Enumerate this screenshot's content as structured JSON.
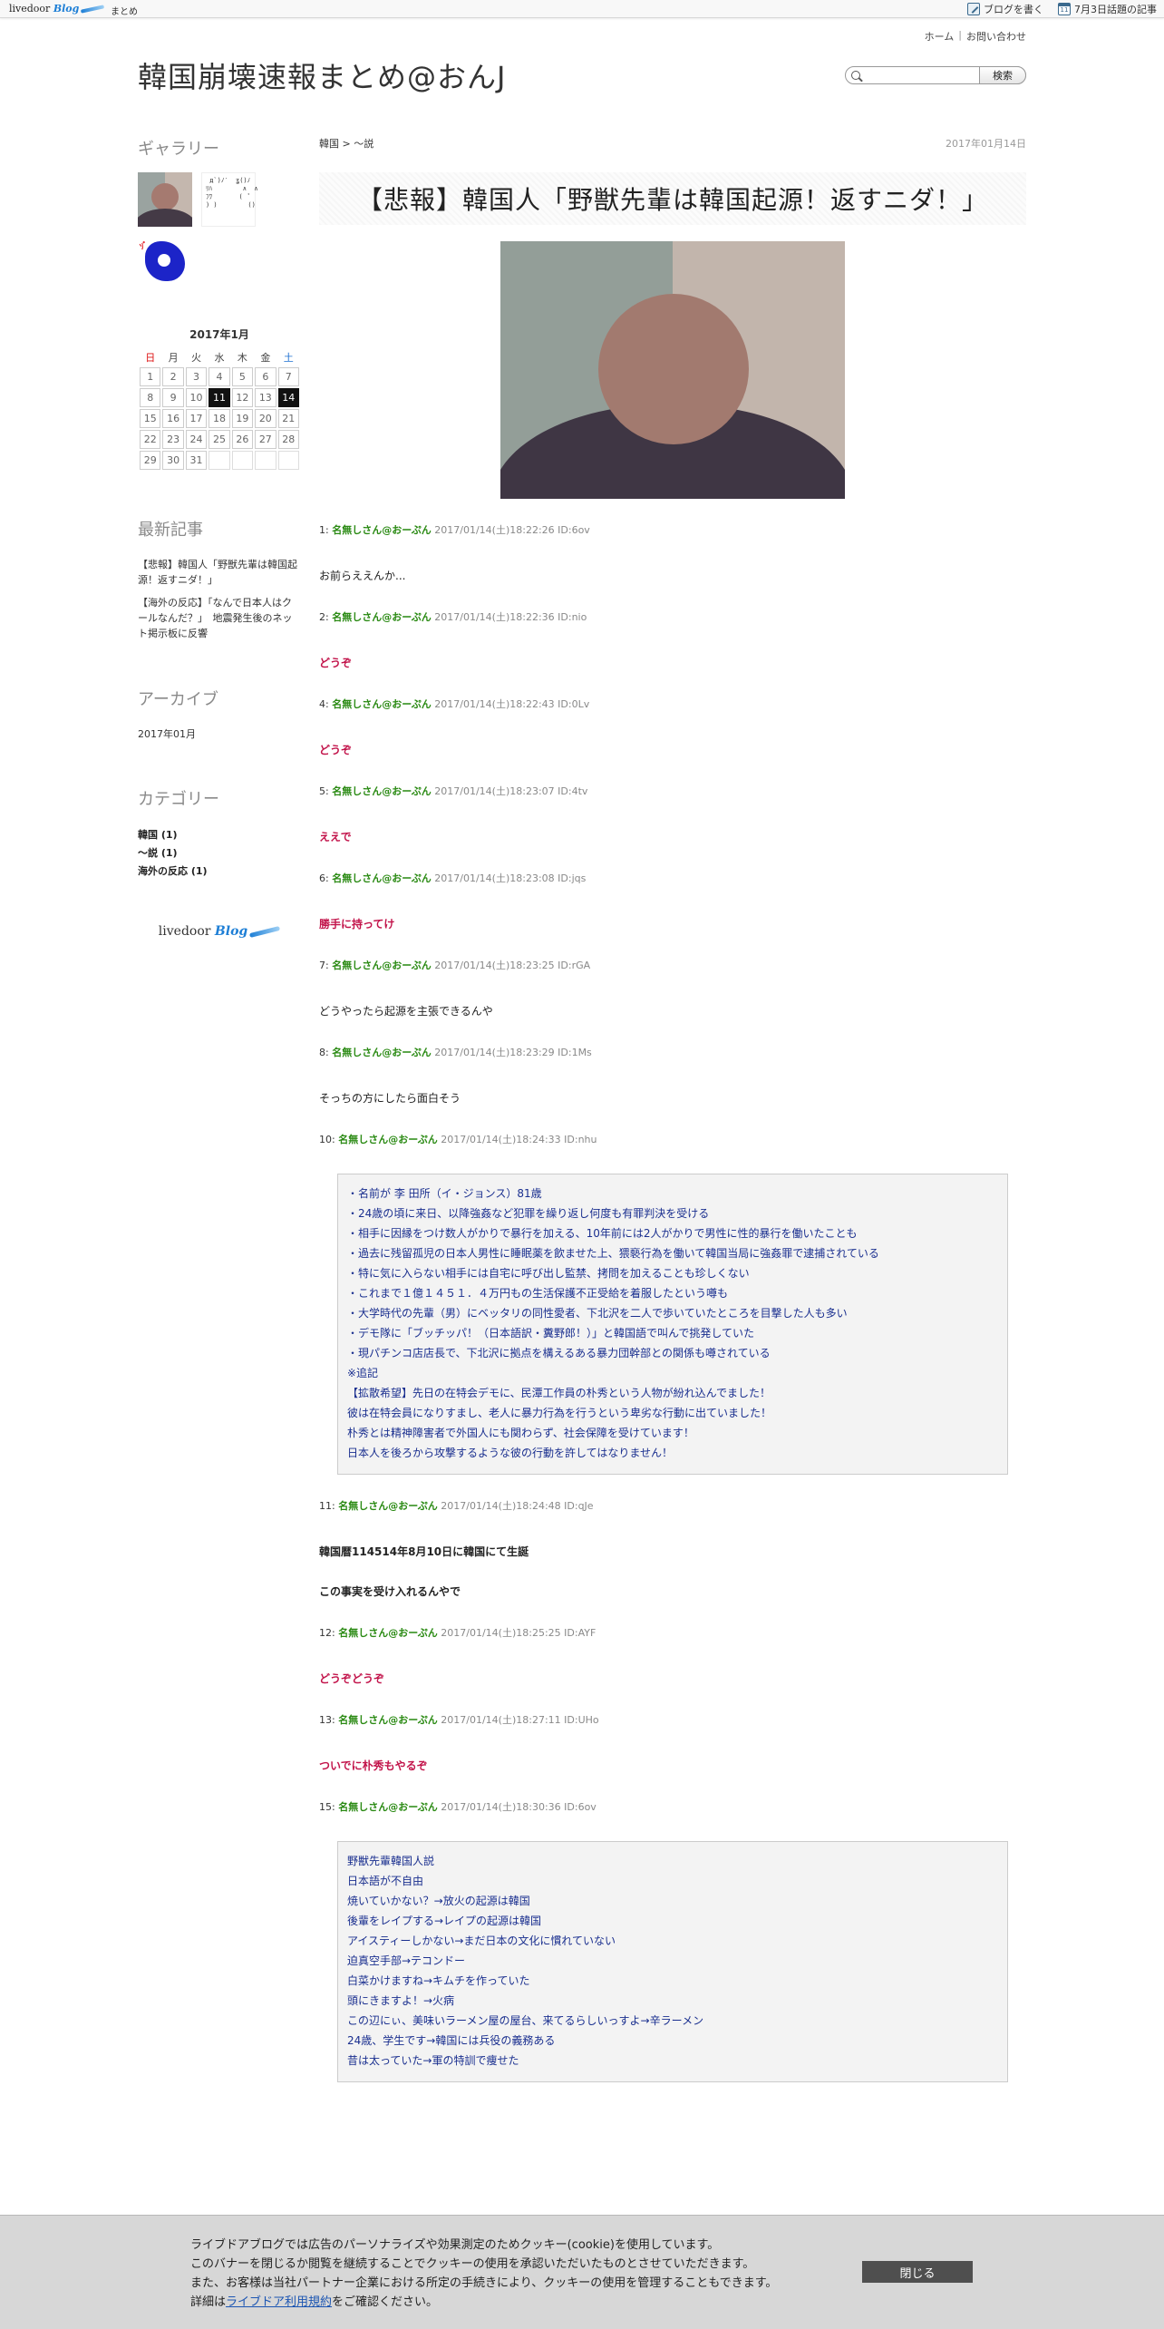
{
  "topbar": {
    "logo_text": "livedoor",
    "logo_blog": "Blog",
    "matome": "まとめ",
    "write_blog": "ブログを書く",
    "trending": "7月3日話題の記事",
    "cal_icon_num": "11"
  },
  "header": {
    "home": "ホーム",
    "sep": "|",
    "contact": "お問い合わせ",
    "site_title": "韓国崩壊速報まとめ@おんJ",
    "search_placeholder": "",
    "search_button": "検索"
  },
  "sidebar": {
    "gallery_title": "ギャラリー",
    "gallery_thumb2_text": " д`)ﾉ′  ʓ()ﾉ\nﾘﾊ        ∧  ∧\nﾌﾜ       (  ﾟ\n) )        ()",
    "gallery_thumb3_text": "ｿﾞ",
    "calendar": {
      "title": "2017年1月",
      "weekdays": [
        "日",
        "月",
        "火",
        "水",
        "木",
        "金",
        "土"
      ],
      "weeks": [
        [
          "1",
          "2",
          "3",
          "4",
          "5",
          "6",
          "7"
        ],
        [
          "8",
          "9",
          "10",
          "11",
          "12",
          "13",
          "14"
        ],
        [
          "15",
          "16",
          "17",
          "18",
          "19",
          "20",
          "21"
        ],
        [
          "22",
          "23",
          "24",
          "25",
          "26",
          "27",
          "28"
        ],
        [
          "29",
          "30",
          "31",
          "",
          "",
          "",
          ""
        ]
      ],
      "highlighted": [
        "11",
        "14"
      ]
    },
    "recent_title": "最新記事",
    "recent": [
      "【悲報】韓国人「野獣先輩は韓国起源！返すニダ！」",
      "【海外の反応】「なんで日本人はクールなんだ？」　地震発生後のネット掲示板に反響"
    ],
    "archive_title": "アーカイブ",
    "archive": [
      "2017年01月"
    ],
    "category_title": "カテゴリー",
    "categories": [
      "韓国 (1)",
      "〜説 (1)",
      "海外の反応 (1)"
    ],
    "footer_logo_text": "livedoor",
    "footer_logo_blog": "Blog"
  },
  "article": {
    "breadcrumb": "韓国 > 〜説",
    "date": "2017年01月14日",
    "title": "【悲報】韓国人「野獣先輩は韓国起源！返すニダ！」",
    "comments": [
      {
        "num": "1:",
        "name": "名無しさん@おーぷん",
        "meta": "2017/01/14(土)18:22:26 ID:6ov",
        "style": "plain",
        "lines": [
          "お前らええんか..."
        ]
      },
      {
        "num": "2:",
        "name": "名無しさん@おーぷん",
        "meta": "2017/01/14(土)18:22:36 ID:nio",
        "style": "red",
        "lines": [
          "どうぞ"
        ]
      },
      {
        "num": "4:",
        "name": "名無しさん@おーぷん",
        "meta": "2017/01/14(土)18:22:43 ID:0Lv",
        "style": "red",
        "lines": [
          "どうぞ"
        ]
      },
      {
        "num": "5:",
        "name": "名無しさん@おーぷん",
        "meta": "2017/01/14(土)18:23:07 ID:4tv",
        "style": "red",
        "lines": [
          "ええで"
        ]
      },
      {
        "num": "6:",
        "name": "名無しさん@おーぷん",
        "meta": "2017/01/14(土)18:23:08 ID:jqs",
        "style": "red",
        "lines": [
          "勝手に持ってけ"
        ]
      },
      {
        "num": "7:",
        "name": "名無しさん@おーぷん",
        "meta": "2017/01/14(土)18:23:25 ID:rGA",
        "style": "plain",
        "lines": [
          "どうやったら起源を主張できるんや"
        ]
      },
      {
        "num": "8:",
        "name": "名無しさん@おーぷん",
        "meta": "2017/01/14(土)18:23:29 ID:1Ms",
        "style": "plain",
        "lines": [
          "そっちの方にしたら面白そう"
        ]
      }
    ],
    "comment10": {
      "num": "10:",
      "name": "名無しさん@おーぷん",
      "meta": "2017/01/14(土)18:24:33 ID:nhu",
      "quote": [
        "・名前が 李 田所（イ・ジョンス）81歳",
        "・24歳の頃に来日、以降強姦など犯罪を繰り返し何度も有罪判決を受ける",
        "・相手に因縁をつけ数人がかりで暴行を加える、10年前には2人がかりで男性に性的暴行を働いたことも",
        "・過去に残留孤児の日本人男性に睡眠薬を飲ませた上、猥褻行為を働いて韓国当局に強姦罪で逮捕されている",
        "・特に気に入らない相手には自宅に呼び出し監禁、拷問を加えることも珍しくない",
        "・これまで１億１４５１．４万円もの生活保護不正受給を着服したという噂も",
        "・大学時代の先輩（男）にベッタリの同性愛者、下北沢を二人で歩いていたところを目撃した人も多い",
        "・デモ隊に「ブッチッパ！（日本語訳・糞野郎！）」と韓国語で叫んで挑発していた",
        "・現パチンコ店店長で、下北沢に拠点を構えるある暴力団幹部との関係も噂されている",
        "※追記",
        "【拡散希望】先日の在特会デモに、民潭工作員の朴秀という人物が紛れ込んでました！",
        "彼は在特会員になりすまし、老人に暴力行為を行うという卑劣な行動に出ていました！",
        "朴秀とは精神障害者で外国人にも関わらず、社会保障を受けています！",
        "日本人を後ろから攻撃するような彼の行動を許してはなりません！"
      ]
    },
    "comments_after": [
      {
        "num": "11:",
        "name": "名無しさん@おーぷん",
        "meta": "2017/01/14(土)18:24:48 ID:qJe",
        "style": "bold",
        "lines": [
          "韓国暦114514年8月10日に韓国にて生誕",
          "",
          "この事実を受け入れるんやで"
        ]
      },
      {
        "num": "12:",
        "name": "名無しさん@おーぷん",
        "meta": "2017/01/14(土)18:25:25 ID:AYF",
        "style": "red",
        "lines": [
          "どうぞどうぞ"
        ]
      },
      {
        "num": "13:",
        "name": "名無しさん@おーぷん",
        "meta": "2017/01/14(土)18:27:11 ID:UHo",
        "style": "red",
        "lines": [
          "ついでに朴秀もやるぞ"
        ]
      }
    ],
    "comment15": {
      "num": "15:",
      "name": "名無しさん@おーぷん",
      "meta": "2017/01/14(土)18:30:36 ID:6ov",
      "quote": [
        "野獣先輩韓国人説",
        "日本語が不自由",
        "焼いていかない？→放火の起源は韓国",
        "後輩をレイプする→レイプの起源は韓国",
        "アイスティーしかない→まだ日本の文化に慣れていない",
        "迫真空手部→テコンドー",
        "白菜かけますね→キムチを作っていた",
        "頭にきますよ！→火病",
        "この辺にぃ、美味いラーメン屋の屋台、来てるらしいっすよ→辛ラーメン",
        "24歳、学生です→韓国には兵役の義務ある",
        "昔は太っていた→軍の特訓で痩せた"
      ]
    }
  },
  "cookie": {
    "line1": "ライブドアブログでは広告のパーソナライズや効果測定のためクッキー(cookie)を使用しています。",
    "line2": "このバナーを閉じるか閲覧を継続することでクッキーの使用を承認いただいたものとさせていただきます。",
    "line3": "また、お客様は当社パートナー企業における所定の手続きにより、クッキーの使用を管理することもできます。",
    "line4_pre": "詳細は",
    "line4_link": "ライブドア利用規約",
    "line4_post": "をご確認ください。",
    "close": "閉じる"
  },
  "colors": {
    "accent_green": "#2a8a13",
    "accent_red": "#c2134a",
    "quote_blue": "#1a2f8f",
    "brand_blue": "#1e7fd6"
  }
}
